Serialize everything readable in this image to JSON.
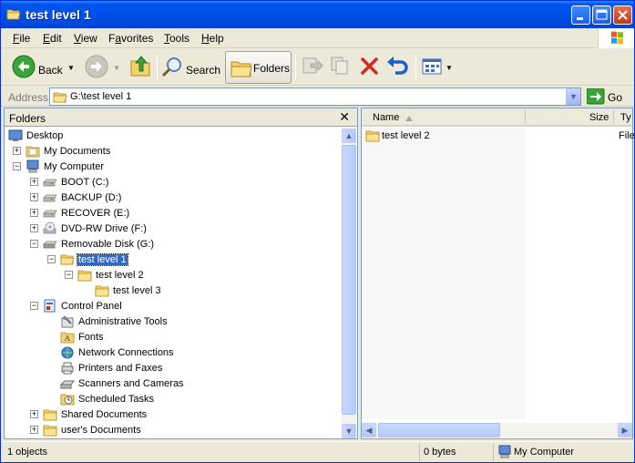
{
  "window": {
    "title": "test level 1"
  },
  "menu": {
    "items": [
      {
        "accel": "F",
        "rest": "ile"
      },
      {
        "accel": "E",
        "rest": "dit"
      },
      {
        "accel": "V",
        "rest": "iew"
      },
      {
        "accel": "a",
        "pre": "F",
        "rest": "vorites"
      },
      {
        "accel": "T",
        "rest": "ools"
      },
      {
        "accel": "H",
        "rest": "elp"
      }
    ]
  },
  "toolbar": {
    "back_label": "Back",
    "search_label": "Search",
    "folders_label": "Folders"
  },
  "address": {
    "label": "Address",
    "value": "G:\\test level 1",
    "go_label": "Go"
  },
  "folders_pane": {
    "title": "Folders",
    "tree": [
      {
        "label": "Desktop",
        "icon": "desktop-icon",
        "level": 0,
        "expander": ""
      },
      {
        "label": "My Documents",
        "icon": "my-documents-icon",
        "level": 1,
        "expander": "+"
      },
      {
        "label": "My Computer",
        "icon": "my-computer-icon",
        "level": 1,
        "expander": "-"
      },
      {
        "label": "BOOT (C:)",
        "icon": "drive-icon",
        "level": 2,
        "expander": "+"
      },
      {
        "label": "BACKUP (D:)",
        "icon": "drive-icon",
        "level": 2,
        "expander": "+"
      },
      {
        "label": "RECOVER (E:)",
        "icon": "drive-icon",
        "level": 2,
        "expander": "+"
      },
      {
        "label": "DVD-RW Drive (F:)",
        "icon": "dvd-drive-icon",
        "level": 2,
        "expander": "+"
      },
      {
        "label": "Removable Disk (G:)",
        "icon": "removable-disk-icon",
        "level": 2,
        "expander": "-"
      },
      {
        "label": "test level 1",
        "icon": "folder-open-icon",
        "level": 3,
        "expander": "-",
        "selected": true
      },
      {
        "label": "test level 2",
        "icon": "folder-icon",
        "level": 4,
        "expander": "-"
      },
      {
        "label": "test level 3",
        "icon": "folder-icon",
        "level": 5,
        "expander": ""
      },
      {
        "label": "Control Panel",
        "icon": "control-panel-icon",
        "level": 2,
        "expander": "-"
      },
      {
        "label": "Administrative Tools",
        "icon": "admin-tools-icon",
        "level": 3,
        "expander": ""
      },
      {
        "label": "Fonts",
        "icon": "fonts-folder-icon",
        "level": 3,
        "expander": ""
      },
      {
        "label": "Network Connections",
        "icon": "network-connections-icon",
        "level": 3,
        "expander": ""
      },
      {
        "label": "Printers and Faxes",
        "icon": "printer-icon",
        "level": 3,
        "expander": ""
      },
      {
        "label": "Scanners and Cameras",
        "icon": "scanner-icon",
        "level": 3,
        "expander": ""
      },
      {
        "label": "Scheduled Tasks",
        "icon": "scheduled-tasks-icon",
        "level": 3,
        "expander": ""
      },
      {
        "label": "Shared Documents",
        "icon": "folder-icon",
        "level": 2,
        "expander": "+"
      },
      {
        "label": "user's Documents",
        "icon": "folder-icon",
        "level": 2,
        "expander": "+"
      }
    ]
  },
  "list_pane": {
    "columns": [
      "Name",
      "Size",
      "Ty"
    ],
    "rows": [
      {
        "name": "test level 2",
        "size": "",
        "type": "File"
      }
    ]
  },
  "statusbar": {
    "objects": "1 objects",
    "size": "0 bytes",
    "location": "My Computer"
  },
  "colors": {
    "titlebar_blue": "#0053ee",
    "selection_blue": "#316ac5",
    "folder_yellow": "#f4d36b",
    "window_face": "#ece9d8"
  }
}
